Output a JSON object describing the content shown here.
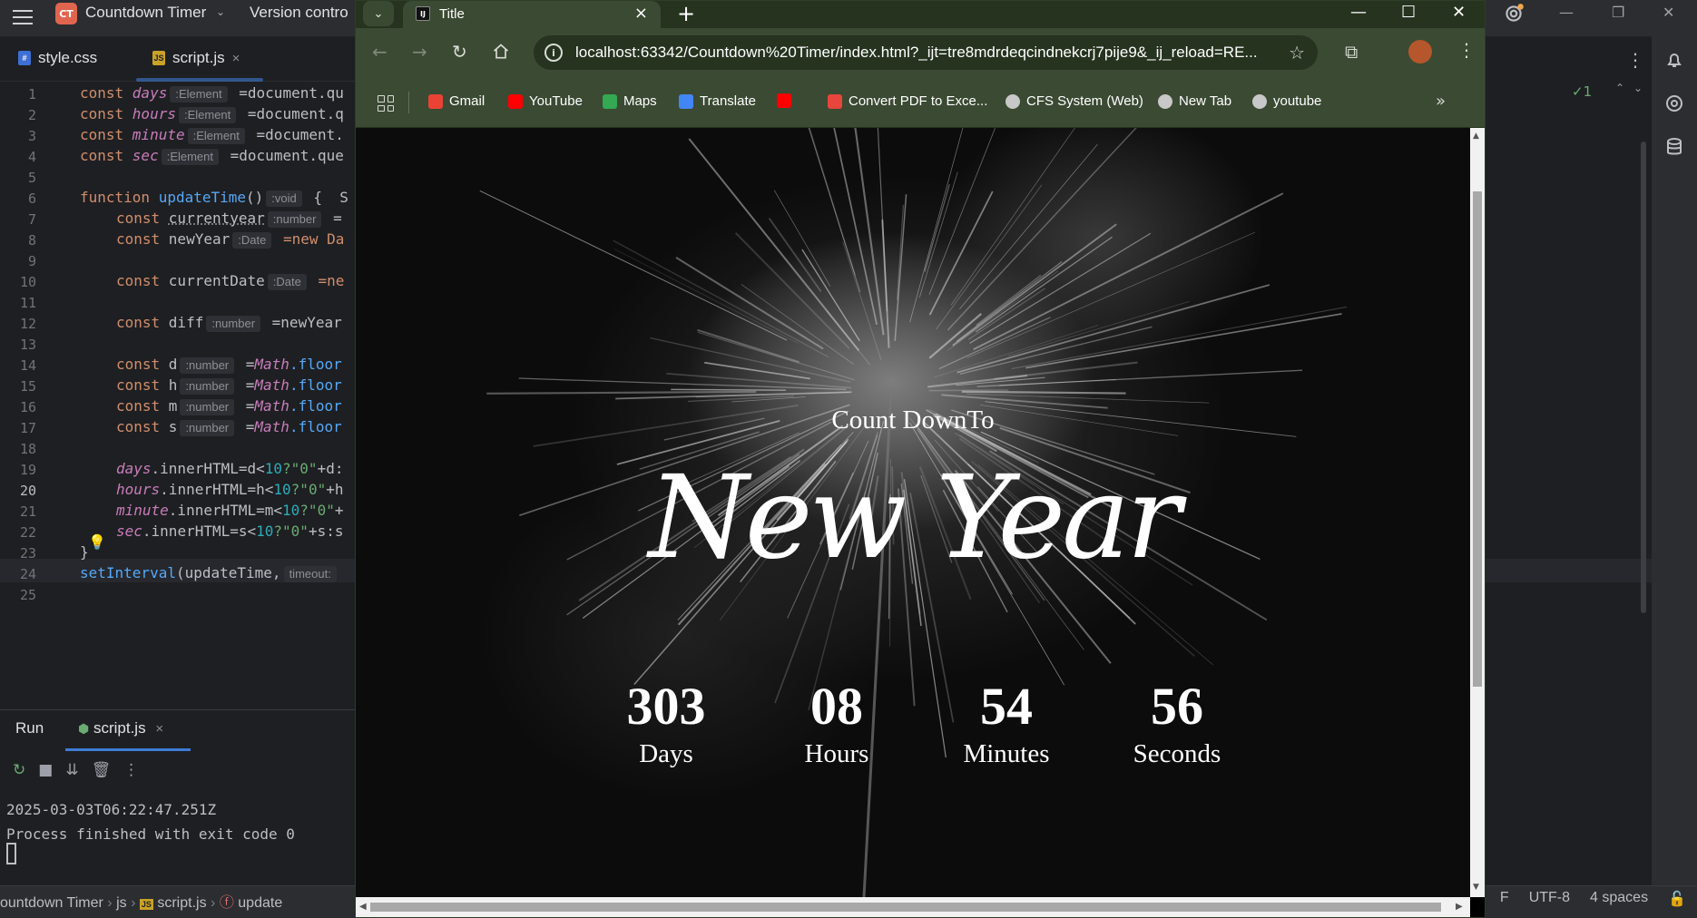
{
  "ide": {
    "project_badge": "CT",
    "project_name": "Countdown Timer",
    "vcs_label": "Version contro",
    "tabs": [
      {
        "label": "style.css",
        "icon": "css-file-icon"
      },
      {
        "label": "script.js",
        "icon": "js-file-icon",
        "close": "×"
      }
    ],
    "line_numbers": [
      "1",
      "2",
      "3",
      "4",
      "5",
      "6",
      "7",
      "8",
      "9",
      "10",
      "11",
      "12",
      "13",
      "14",
      "15",
      "16",
      "17",
      "18",
      "19",
      "20",
      "21",
      "22",
      "23",
      "24",
      "25"
    ],
    "code": {
      "l1": {
        "kw": "const ",
        "var": "days",
        "hint": ":Element",
        "rest": " =document.qu"
      },
      "l2": {
        "kw": "const ",
        "var": "hours",
        "hint": ":Element",
        "rest": " =document.q"
      },
      "l3": {
        "kw": "const ",
        "var": "minute",
        "hint": ":Element",
        "rest": " =document."
      },
      "l4": {
        "kw": "const ",
        "var": "sec",
        "hint": ":Element",
        "rest": " =document.que"
      },
      "l6": {
        "kw": "function ",
        "fn": "updateTime",
        "rest": "()",
        "hint": ":void",
        "tail": " {  S"
      },
      "l7": {
        "kw": "const ",
        "name": "currentyear",
        "hint": ":number",
        "rest": " ="
      },
      "l8": {
        "kw": "const ",
        "name": "newYear",
        "hint": ":Date",
        "rest": " =new Da"
      },
      "l10": {
        "kw": "const ",
        "name": "currentDate",
        "hint": ":Date",
        "rest": " =ne"
      },
      "l12": {
        "kw": "const ",
        "name": "diff",
        "hint": ":number",
        "rest": " =newYear"
      },
      "l14": {
        "kw": "const ",
        "name": "d",
        "hint": ":number",
        "rest": " =",
        "math": "Math",
        "tail": ".floor"
      },
      "l15": {
        "kw": "const ",
        "name": "h",
        "hint": ":number",
        "rest": " =",
        "math": "Math",
        "tail": ".floor"
      },
      "l16": {
        "kw": "const ",
        "name": "m",
        "hint": ":number",
        "rest": " =",
        "math": "Math",
        "tail": ".floor"
      },
      "l17": {
        "kw": "const ",
        "name": "s",
        "hint": ":number",
        "rest": " =",
        "math": "Math",
        "tail": ".floor"
      },
      "l19": {
        "var": "days",
        "rest": ".innerHTML=d<",
        "num": "10",
        "str": "?\"0\"",
        "tail": "+d:"
      },
      "l20": {
        "var": "hours",
        "rest": ".innerHTML=h<",
        "num": "10",
        "str": "?\"0\"",
        "tail": "+h"
      },
      "l21": {
        "var": "minute",
        "rest": ".innerHTML=m<",
        "num": "10",
        "str": "?\"0\"",
        "tail": "+"
      },
      "l22": {
        "var": "sec",
        "rest": ".innerHTML=s<",
        "num": "10",
        "str": "?\"0\"",
        "tail": "+s:s"
      },
      "l23": {
        "rest": "}"
      },
      "l24": {
        "fn": "setInterval",
        "rest": "(updateTime,",
        "hint": "timeout:"
      }
    },
    "run": {
      "title": "Run",
      "tab": "script.js",
      "tab_close": "×",
      "output_line1": "2025-03-03T06:22:47.251Z",
      "output_line2": "Process finished with exit code 0"
    },
    "status": {
      "crumb_project": "ountdown Timer",
      "crumb_dir": "js",
      "crumb_file": "script.js",
      "crumb_fn": "update",
      "encoding": "UTF-8",
      "indent": "4 spaces",
      "line_sep": "F"
    },
    "inspections": "✓1"
  },
  "browser": {
    "tab_title": "Title",
    "tab_close": "×",
    "new_tab": "+",
    "url": "localhost:63342/Countdown%20Timer/index.html?_ijt=tre8mdrdeqcindnekcrj7pije9&_ij_reload=RE...",
    "bookmarks": [
      {
        "label": "Gmail",
        "color": "#ea4335"
      },
      {
        "label": "YouTube",
        "color": "#ff0000"
      },
      {
        "label": "Maps",
        "color": "#34a853"
      },
      {
        "label": "Translate",
        "color": "#4285f4"
      },
      {
        "label": "",
        "color": "#ff0000"
      },
      {
        "label": "Convert PDF to Exce...",
        "color": "#e8453c"
      },
      {
        "label": "CFS System (Web)",
        "color": "#c8c8c8"
      },
      {
        "label": "New Tab",
        "color": "#c8c8c8"
      },
      {
        "label": "youtube",
        "color": "#c8c8c8"
      }
    ]
  },
  "page": {
    "count_label": "Count DownTo",
    "headline": "New Year",
    "counters": [
      {
        "value": "303",
        "unit": "Days"
      },
      {
        "value": "08",
        "unit": "Hours"
      },
      {
        "value": "54",
        "unit": "Minutes"
      },
      {
        "value": "56",
        "unit": "Seconds"
      }
    ]
  }
}
